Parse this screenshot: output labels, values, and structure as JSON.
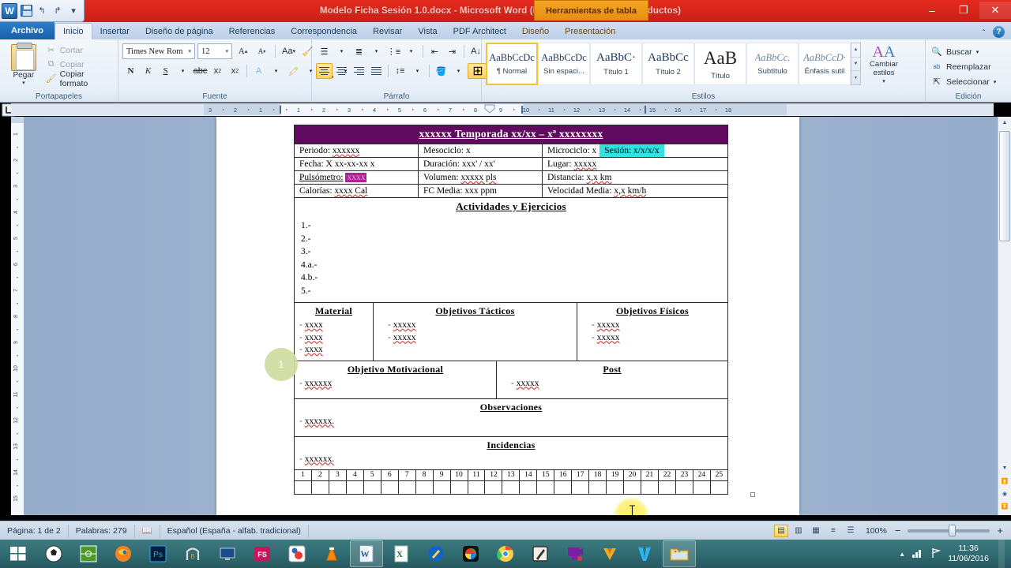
{
  "titlebar": {
    "app_logo": "word-logo",
    "document_title": "Modelo Ficha Sesión 1.0.docx - Microsoft Word (Error de activación de productos)",
    "contextual_tab_group": "Herramientas de tabla",
    "minimize": "–",
    "restore": "❐",
    "close": "✕"
  },
  "tabs": [
    {
      "label": "Archivo",
      "kind": "file"
    },
    {
      "label": "Inicio",
      "kind": "active"
    },
    {
      "label": "Insertar",
      "kind": "normal"
    },
    {
      "label": "Diseño de página",
      "kind": "normal"
    },
    {
      "label": "Referencias",
      "kind": "normal"
    },
    {
      "label": "Correspondencia",
      "kind": "normal"
    },
    {
      "label": "Revisar",
      "kind": "normal"
    },
    {
      "label": "Vista",
      "kind": "normal"
    },
    {
      "label": "PDF Architect",
      "kind": "normal"
    },
    {
      "label": "Diseño",
      "kind": "contextual"
    },
    {
      "label": "Presentación",
      "kind": "contextual"
    }
  ],
  "ribbon": {
    "clipboard": {
      "group_label": "Portapapeles",
      "paste_label": "Pegar",
      "commands": [
        {
          "label": "Cortar",
          "icon": "scissors-icon",
          "enabled": false
        },
        {
          "label": "Copiar",
          "icon": "copy-icon",
          "enabled": false
        },
        {
          "label": "Copiar formato",
          "icon": "format-painter-icon",
          "enabled": true
        }
      ]
    },
    "font": {
      "group_label": "Fuente",
      "font_name": "Times New Rom",
      "font_size": "12",
      "buttons": [
        "grow-font-icon",
        "shrink-font-icon",
        "change-case-icon",
        "clear-formatting-icon",
        "bold-icon",
        "italic-icon",
        "underline-icon",
        "strikethrough-icon",
        "subscript-icon",
        "superscript-icon",
        "text-effects-icon",
        "highlight-icon",
        "font-color-icon"
      ],
      "bold_glyph": "N",
      "italic_glyph": "K",
      "underline_glyph": "S"
    },
    "paragraph": {
      "group_label": "Párrafo",
      "buttons": [
        "bullets-icon",
        "numbering-icon",
        "multilevel-list-icon",
        "decrease-indent-icon",
        "increase-indent-icon",
        "sort-icon",
        "show-marks-icon",
        "align-left-icon",
        "align-center-icon",
        "align-right-icon",
        "justify-icon",
        "line-spacing-icon",
        "shading-icon",
        "borders-icon"
      ]
    },
    "styles": {
      "group_label": "Estilos",
      "items": [
        {
          "preview": "AaBbCcDc",
          "name": "¶ Normal",
          "selected": true
        },
        {
          "preview": "AaBbCcDc",
          "name": "Sin espaci...",
          "selected": false
        },
        {
          "preview": "AaBbC·",
          "name": "Título 1",
          "selected": false
        },
        {
          "preview": "AaBbCc",
          "name": "Título 2",
          "selected": false
        },
        {
          "preview": "AaB",
          "name": "Título",
          "selected": false
        },
        {
          "preview": "AaBbCc.",
          "name": "Subtítulo",
          "selected": false
        },
        {
          "preview": "AaBbCcD·",
          "name": "Énfasis sutil",
          "selected": false
        }
      ],
      "change_styles_label": "Cambiar estilos"
    },
    "editing": {
      "group_label": "Edición",
      "commands": [
        {
          "label": "Buscar",
          "icon": "binoculars-icon"
        },
        {
          "label": "Reemplazar",
          "icon": "replace-icon"
        },
        {
          "label": "Seleccionar",
          "icon": "select-icon"
        }
      ]
    }
  },
  "rulers": {
    "horizontal_ticks": [
      "3",
      "2",
      "1",
      "1",
      "2",
      "3",
      "4",
      "5",
      "6",
      "7",
      "8",
      "9",
      "10",
      "11",
      "12",
      "13",
      "14",
      "15",
      "16",
      "17",
      "18"
    ],
    "vertical_ticks": [
      "1",
      "2",
      "3",
      "4",
      "5",
      "6",
      "7",
      "8",
      "9",
      "10",
      "11",
      "12",
      "13",
      "14",
      "15"
    ],
    "corner_tab_stop": "L"
  },
  "document": {
    "title": "xxxxxx Temporada xx/xx – xª xxxxxxxx",
    "info_rows": [
      {
        "cells": [
          {
            "label": "Periodo:",
            "value": "xxxxxx"
          },
          {
            "label": "Mesociclo:",
            "value": "x"
          },
          {
            "label": "Microciclo:",
            "value": "x"
          }
        ],
        "highlight": {
          "label": "Sesión:",
          "value": "x/x/x/x",
          "color": "#2fe3e3"
        }
      },
      {
        "cells": [
          {
            "label": "Fecha:",
            "value": "X xx-xx-xx  x"
          },
          {
            "label": "Duración:",
            "value": "xxx' / xx'"
          },
          {
            "label": "Lugar:",
            "value": "xxxxx"
          }
        ]
      },
      {
        "cells": [
          {
            "label": "Pulsómetro:",
            "value": "xxxx",
            "selected": true
          },
          {
            "label": "Volumen:",
            "value": "xxxxx pls"
          },
          {
            "label": "Distancia:",
            "value": "x,x km"
          }
        ]
      },
      {
        "cells": [
          {
            "label": "Calorías:",
            "value": "xxxx Cal"
          },
          {
            "label": "FC Media:",
            "value": "xxx ppm"
          },
          {
            "label": "Velocidad Media:",
            "value": "x,x km/h"
          }
        ]
      }
    ],
    "activities": {
      "heading": "Actividades y Ejercicios",
      "items": [
        "1.-",
        "2.-",
        "3.-",
        "4.a.-",
        "4.b.-",
        "5.-"
      ]
    },
    "three_cols": [
      {
        "heading": "Material",
        "items": [
          "xxxx",
          "xxxx",
          "xxxx"
        ]
      },
      {
        "heading": "Objetivos Tácticos",
        "items": [
          "xxxxx",
          "xxxxx"
        ]
      },
      {
        "heading": "Objetivos Físicos",
        "items": [
          "xxxxx",
          "xxxxx"
        ]
      }
    ],
    "two_cols": [
      {
        "heading": "Objetivo Motivacional",
        "items": [
          "xxxxxx"
        ]
      },
      {
        "heading": "Post",
        "items": [
          "xxxxx"
        ]
      }
    ],
    "observaciones": {
      "heading": "Observaciones",
      "items": [
        "xxxxxx."
      ]
    },
    "incidencias": {
      "heading": "Incidencias",
      "items": [
        "xxxxxx."
      ]
    },
    "number_row": [
      "1",
      "2",
      "3",
      "4",
      "5",
      "6",
      "7",
      "8",
      "9",
      "10",
      "11",
      "12",
      "13",
      "14",
      "15",
      "16",
      "17",
      "18",
      "19",
      "20",
      "21",
      "22",
      "23",
      "24",
      "25"
    ],
    "annotation_badge": "1"
  },
  "statusbar": {
    "page": "Página: 1 de 2",
    "words": "Palabras: 279",
    "proofing_icon": "spellcheck-icon",
    "language": "Español (España - alfab. tradicional)",
    "view_buttons": [
      "print-layout-icon",
      "full-screen-reading-icon",
      "web-layout-icon",
      "outline-icon",
      "draft-icon"
    ],
    "zoom": "100%",
    "zoom_out": "−",
    "zoom_in": "+"
  },
  "taskbar": {
    "start": "windows-start-icon",
    "items": [
      {
        "icon": "soccer-ball-icon",
        "active": false
      },
      {
        "icon": "football-pitch-icon",
        "active": false
      },
      {
        "icon": "firefox-icon",
        "active": false
      },
      {
        "icon": "photoshop-icon",
        "active": false
      },
      {
        "icon": "bitdefender-icon",
        "active": false
      },
      {
        "icon": "remote-desktop-icon",
        "active": false
      },
      {
        "icon": "fs-app-icon",
        "active": false
      },
      {
        "icon": "paint-app-icon",
        "active": false
      },
      {
        "icon": "vlc-icon",
        "active": false
      },
      {
        "icon": "word-icon",
        "active": true
      },
      {
        "icon": "excel-icon",
        "active": false
      },
      {
        "icon": "paint-tool-icon",
        "active": false
      },
      {
        "icon": "color-wheel-icon",
        "active": false
      },
      {
        "icon": "chrome-icon",
        "active": false
      },
      {
        "icon": "notepad-pen-icon",
        "active": false
      },
      {
        "icon": "camtasia-icon",
        "active": false
      },
      {
        "icon": "handbrake-icon",
        "active": false
      },
      {
        "icon": "avs-video-icon",
        "active": false
      },
      {
        "icon": "explorer-folder-icon",
        "active": true
      }
    ],
    "tray": {
      "show_hidden": "▲",
      "network_icon": "network-icon",
      "flag_icon": "action-center-icon"
    },
    "time": "11:36",
    "date": "11/06/2016"
  }
}
